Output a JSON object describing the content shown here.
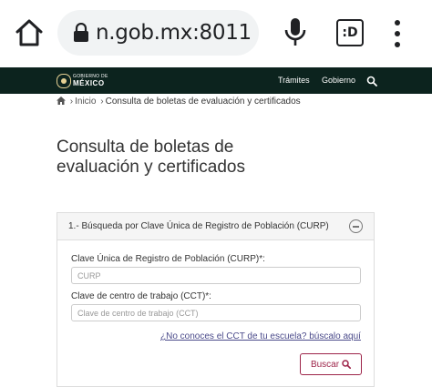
{
  "browser": {
    "url": "n.gob.mx:8011",
    "tab_switcher_label": ":D"
  },
  "gov_nav": {
    "logo_top": "GOBIERNO DE",
    "logo_main": "MÉXICO",
    "links": [
      "Trámites",
      "Gobierno"
    ]
  },
  "breadcrumb": {
    "home": "Inicio",
    "current": "Consulta de boletas de evaluación y certificados"
  },
  "page": {
    "title": "Consulta de boletas de evaluación y certificados"
  },
  "panel": {
    "title": "1.- Búsqueda por Clave Única de Registro de Población (CURP)",
    "curp_label": "Clave Única de Registro de Población (CURP)*:",
    "curp_placeholder": "CURP",
    "curp_value": "",
    "cct_label": "Clave de centro de trabajo (CCT)*:",
    "cct_placeholder": "Clave de centro de trabajo (CCT)",
    "cct_value": "",
    "help_link": "¿No conoces el CCT de tu escuela? búscalo aquí",
    "search_button": "Buscar"
  },
  "colors": {
    "nav_background": "#0c231e",
    "accent": "#9d2449",
    "logo_gold": "#e6d194"
  },
  "icons": [
    "home-icon",
    "lock-icon",
    "mic-icon",
    "tab-switcher-icon",
    "more-vert-icon",
    "search-icon",
    "collapse-icon"
  ]
}
